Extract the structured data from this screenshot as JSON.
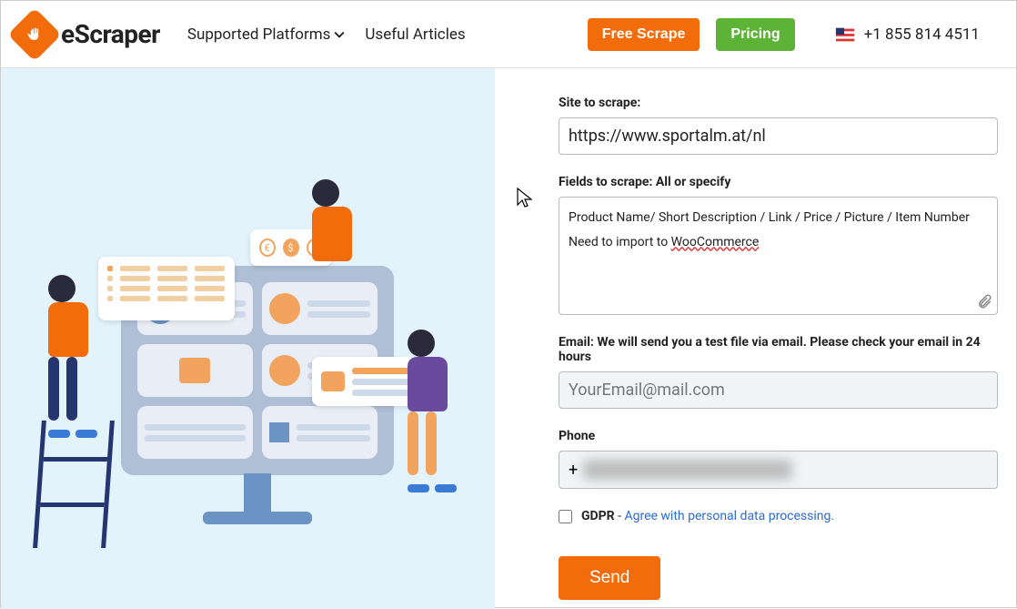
{
  "brand": {
    "name": "eScraper"
  },
  "nav": {
    "supported_platforms": "Supported Platforms",
    "useful_articles": "Useful Articles"
  },
  "buttons": {
    "free_scrape": "Free Scrape",
    "pricing": "Pricing",
    "send": "Send"
  },
  "contact": {
    "phone": "+1 855 814 4511"
  },
  "form": {
    "site_label": "Site to scrape:",
    "site_value": "https://www.sportalm.at/nl",
    "fields_label": "Fields to scrape: All or specify",
    "fields_line1": "Product Name/ Short Description / Link / Price / Picture / Item Number",
    "fields_line2_prefix": "Need to import to ",
    "fields_line2_link": "WooCommerce",
    "email_label": "Email: We will send you a test file via email. Please check your email in 24 hours",
    "email_placeholder": "YourEmail@mail.com",
    "phone_label": "Phone",
    "phone_prefix": "+",
    "gdpr_label": "GDPR",
    "gdpr_dash": " - ",
    "gdpr_link": "Agree with personal data processing."
  }
}
